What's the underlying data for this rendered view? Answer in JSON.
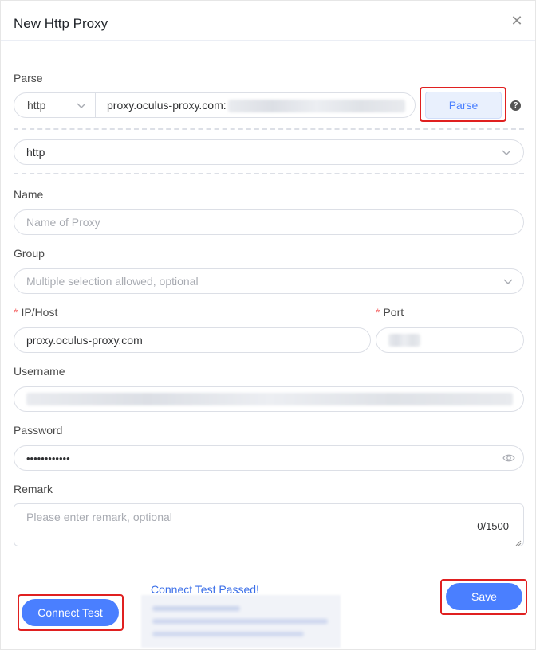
{
  "dialog": {
    "title": "New Http Proxy"
  },
  "parse": {
    "label": "Parse",
    "protocol_value": "http",
    "url_value": "proxy.oculus-proxy.com:",
    "button_label": "Parse",
    "help_icon": "question-circle-icon"
  },
  "type_select": {
    "value": "http"
  },
  "name": {
    "label": "Name",
    "placeholder": "Name of Proxy"
  },
  "group": {
    "label": "Group",
    "placeholder": "Multiple selection allowed, optional"
  },
  "host": {
    "required_mark": "*",
    "label": "IP/Host",
    "value": "proxy.oculus-proxy.com"
  },
  "port": {
    "required_mark": "*",
    "label": "Port"
  },
  "username": {
    "label": "Username"
  },
  "password": {
    "label": "Password",
    "value": "••••••••••••",
    "toggle_icon": "eye-icon"
  },
  "remark": {
    "label": "Remark",
    "placeholder": "Please enter remark, optional",
    "counter": "0/1500"
  },
  "footer": {
    "connect_test_label": "Connect Test",
    "test_status": "Connect Test Passed!",
    "save_label": "Save"
  },
  "colors": {
    "primary": "#4a7fff",
    "highlight": "#e02020",
    "status_link": "#3a6ee8"
  }
}
